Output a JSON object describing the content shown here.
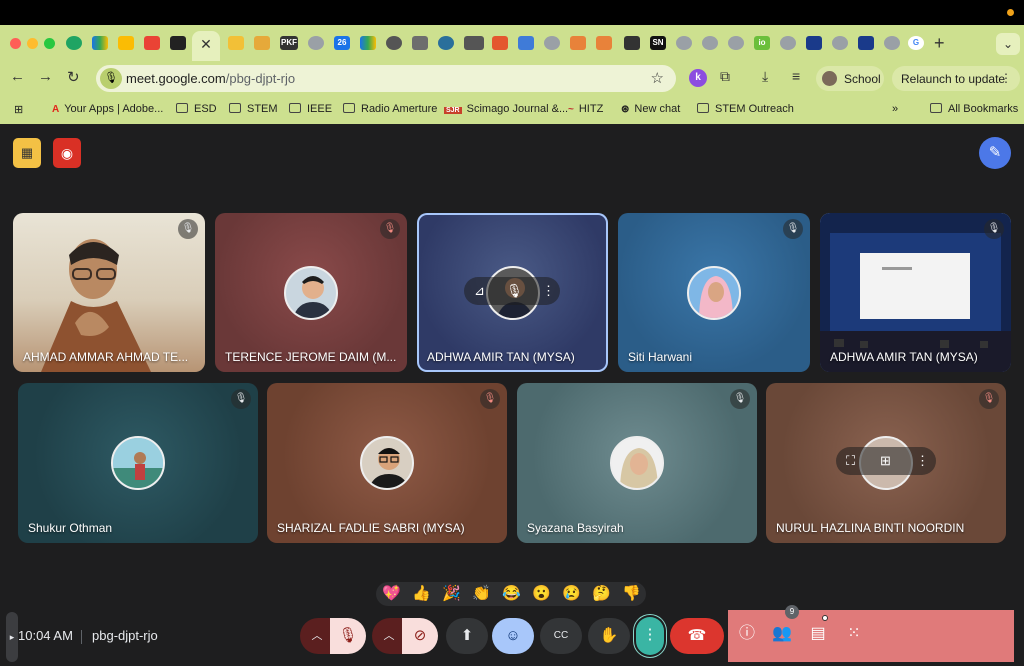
{
  "browser": {
    "url_host": "meet.google.com",
    "url_path": "/pbg-djpt-rjo",
    "profile": "School",
    "relaunch": "Relaunch to update",
    "extension_k": "k",
    "tabs_visible": [
      "PKF",
      "26",
      "SN",
      "io"
    ]
  },
  "bookmarks": [
    {
      "label": "Your Apps | Adobe...",
      "icon": "adobe-icon"
    },
    {
      "label": "ESD",
      "icon": "folder-icon"
    },
    {
      "label": "STEM",
      "icon": "folder-icon"
    },
    {
      "label": "IEEE",
      "icon": "folder-icon"
    },
    {
      "label": "Radio Amerture",
      "icon": "folder-icon"
    },
    {
      "label": "Scimago Journal &...",
      "icon": "sjr-icon",
      "logo": "SJR"
    },
    {
      "label": "HITZ",
      "icon": "hitz-icon"
    },
    {
      "label": "New chat",
      "icon": "openai-icon"
    },
    {
      "label": "STEM Outreach",
      "icon": "folder-icon"
    },
    {
      "label": "All Bookmarks",
      "icon": "folder-icon"
    }
  ],
  "participants": [
    {
      "name": "AHMAD AMMAR AHMAD TE..."
    },
    {
      "name": "TERENCE JEROME DAIM (M..."
    },
    {
      "name": "ADHWA AMIR TAN (MYSA)"
    },
    {
      "name": "Siti Harwani"
    },
    {
      "name": "ADHWA AMIR TAN (MYSA)"
    },
    {
      "name": "Shukur Othman"
    },
    {
      "name": "SHARIZAL FADLIE SABRI (MYSA)"
    },
    {
      "name": "Syazana Basyirah"
    },
    {
      "name": "NURUL HAZLINA BINTI NOORDIN"
    }
  ],
  "meeting": {
    "time": "10:04 AM",
    "code": "pbg-djpt-rjo",
    "participant_count": "9"
  },
  "reactions": [
    "💖",
    "👍",
    "🎉",
    "👏",
    "😂",
    "😮",
    "😢",
    "🤔",
    "👎"
  ],
  "colors": {
    "chrome_bg": "#cde08f",
    "meet_bg": "#1e1e1f",
    "end_call": "#dc362e",
    "panel": "#e07a7a",
    "speaking_border": "#a8c7fa"
  }
}
